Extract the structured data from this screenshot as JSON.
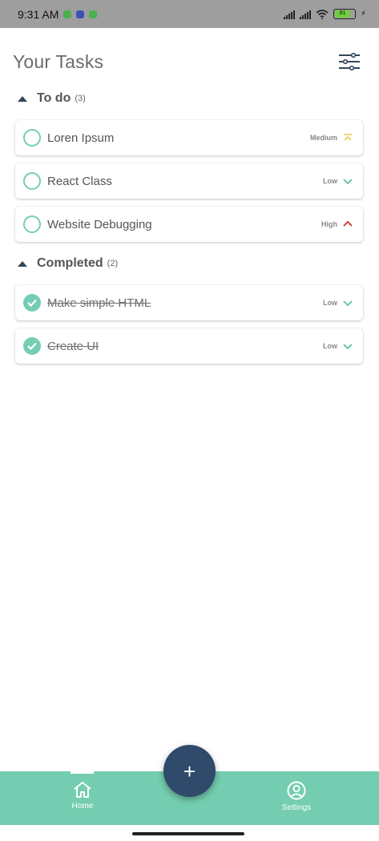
{
  "status_bar": {
    "time": "9:31 AM",
    "battery": "81"
  },
  "header": {
    "title": "Your Tasks"
  },
  "sections": [
    {
      "title": "To do",
      "count": "(3)",
      "tasks": [
        {
          "name": "Loren Ipsum",
          "priority": "Medium",
          "completed": false
        },
        {
          "name": "React Class",
          "priority": "Low",
          "completed": false
        },
        {
          "name": "Website Debugging",
          "priority": "High",
          "completed": false
        }
      ]
    },
    {
      "title": "Completed",
      "count": "(2)",
      "tasks": [
        {
          "name": "Make simple HTML",
          "priority": "Low",
          "completed": true
        },
        {
          "name": "Create UI",
          "priority": "Low",
          "completed": true
        }
      ]
    }
  ],
  "nav": {
    "home_label": "Home",
    "settings_label": "Settings",
    "fab_label": "+"
  },
  "colors": {
    "accent": "#74cdb4",
    "fab": "#2f4a6b",
    "priority_low": "#5bc3a3",
    "priority_medium": "#f2c94c",
    "priority_high": "#d32f2f"
  },
  "icons": {
    "filter": "sliders-icon",
    "home": "home-icon",
    "settings": "user-circle-icon"
  }
}
